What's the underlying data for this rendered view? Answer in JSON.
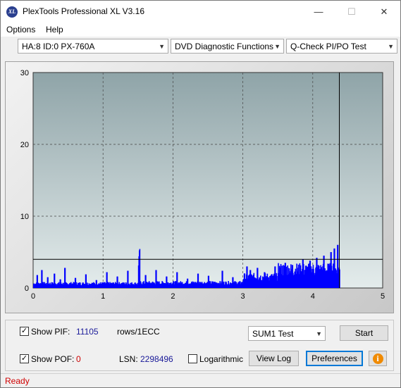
{
  "window": {
    "title": "PlexTools Professional XL V3.16",
    "icon_text": "XL",
    "minimize_glyph": "—",
    "maximize_glyph": "☐",
    "close_glyph": "✕"
  },
  "menu": [
    {
      "label": "Options"
    },
    {
      "label": "Help"
    }
  ],
  "toolbar": {
    "drive": "HA:8 ID:0  PX-760A",
    "function": "DVD Diagnostic Functions",
    "test": "Q-Check PI/PO Test"
  },
  "chart_data": {
    "type": "bar",
    "x_ticks": [
      "0",
      "1",
      "2",
      "3",
      "4",
      "5"
    ],
    "y_ticks": [
      "0",
      "10",
      "20",
      "30"
    ],
    "xlim": [
      0,
      5
    ],
    "ylim": [
      0,
      30
    ],
    "grid": true,
    "threshold_line": 4,
    "end_marker_x": 4.38,
    "bar_color": "#0000ff",
    "background_top": "#8fa4a8",
    "background_bottom": "#e4ecec",
    "segments": [
      {
        "x0": 0.0,
        "x1": 1.5,
        "base": 0.6,
        "spikes": [
          [
            0.05,
            1.8
          ],
          [
            0.12,
            2.5
          ],
          [
            0.2,
            1.5
          ],
          [
            0.3,
            2.0
          ],
          [
            0.38,
            1.2
          ],
          [
            0.45,
            2.8
          ],
          [
            0.6,
            1.4
          ],
          [
            0.75,
            1.9
          ],
          [
            0.9,
            1.1
          ],
          [
            1.05,
            2.2
          ],
          [
            1.2,
            1.6
          ],
          [
            1.35,
            2.4
          ]
        ]
      },
      {
        "x0": 1.5,
        "x1": 1.52,
        "base": 4.0,
        "spikes": []
      },
      {
        "x0": 1.52,
        "x1": 3.0,
        "base": 0.7,
        "spikes": [
          [
            1.6,
            1.8
          ],
          [
            1.75,
            2.5
          ],
          [
            1.9,
            1.6
          ],
          [
            2.05,
            2.2
          ],
          [
            2.2,
            1.3
          ],
          [
            2.35,
            2.0
          ],
          [
            2.5,
            1.7
          ],
          [
            2.7,
            2.4
          ],
          [
            2.85,
            1.5
          ]
        ]
      },
      {
        "x0": 3.0,
        "x1": 3.5,
        "base": 1.5,
        "spikes": [
          [
            3.05,
            3.0
          ],
          [
            3.1,
            2.5
          ],
          [
            3.2,
            2.8
          ],
          [
            3.3,
            2.2
          ],
          [
            3.45,
            3.0
          ]
        ]
      },
      {
        "x0": 3.5,
        "x1": 4.38,
        "base": 2.5,
        "spikes": [
          [
            3.6,
            3.5
          ],
          [
            3.7,
            3.2
          ],
          [
            3.85,
            4.0
          ],
          [
            3.95,
            3.8
          ],
          [
            4.05,
            4.2
          ],
          [
            4.15,
            4.5
          ],
          [
            4.25,
            5.0
          ],
          [
            4.3,
            5.5
          ],
          [
            4.35,
            6.0
          ]
        ]
      }
    ]
  },
  "controls": {
    "show_pif_label": "Show PIF:",
    "show_pif_checked": true,
    "pif_value": "11105",
    "rows_label": "rows/1ECC",
    "show_pof_label": "Show POF:",
    "show_pof_checked": true,
    "pof_value": "0",
    "lsn_label": "LSN:",
    "lsn_value": "2298496",
    "logarithmic_label": "Logarithmic",
    "logarithmic_checked": false,
    "sum_select": "SUM1 Test",
    "start_label": "Start",
    "view_log_label": "View Log",
    "preferences_label": "Preferences",
    "info_glyph": "i"
  },
  "status": {
    "text": "Ready"
  }
}
